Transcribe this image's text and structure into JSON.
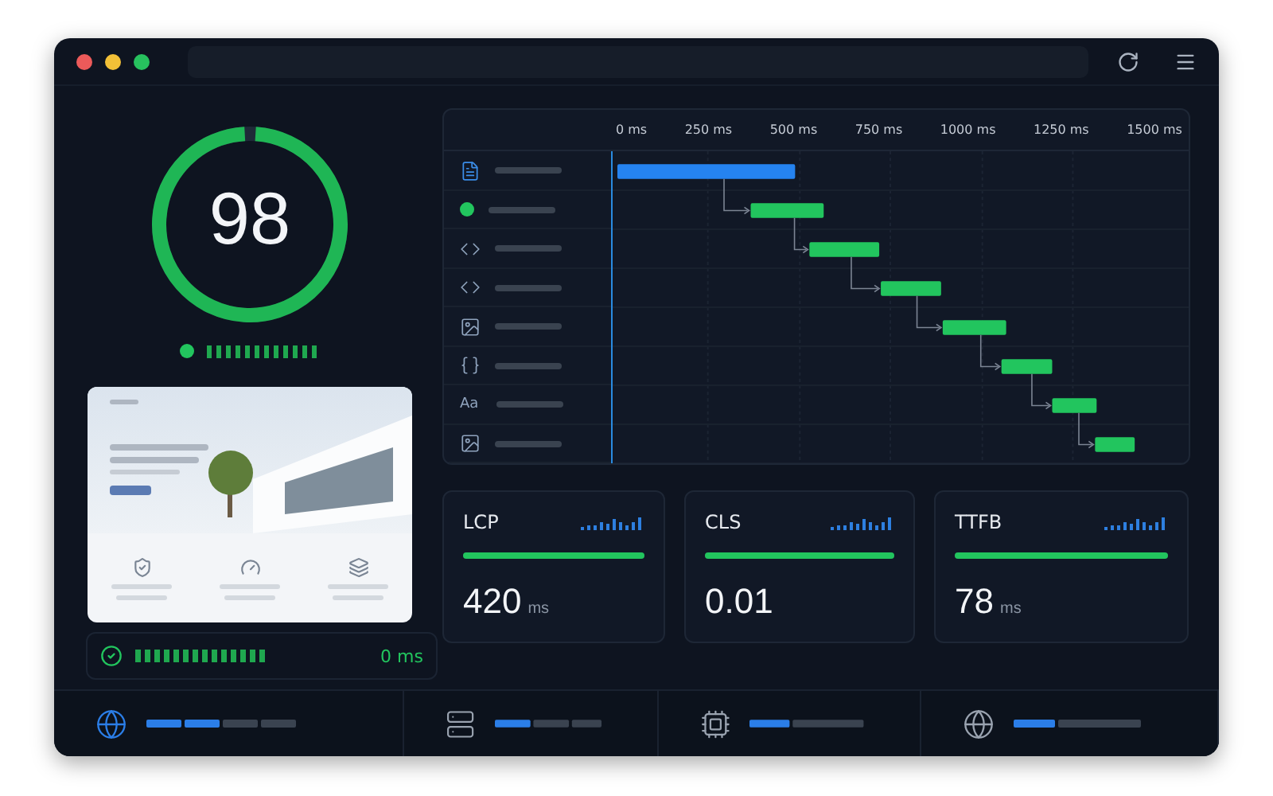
{
  "window": {
    "controls": [
      {
        "color": "#ec5a5a"
      },
      {
        "color": "#f2c037"
      },
      {
        "color": "#27c15e"
      }
    ]
  },
  "score": {
    "value": "98",
    "level": 0.98
  },
  "waterfall": {
    "ticks": [
      "0 ms",
      "250 ms",
      "500 ms",
      "750 ms",
      "1000 ms",
      "1250 ms",
      "1500 ms"
    ],
    "rows": [
      {
        "kind": "document"
      },
      {
        "kind": "dot"
      },
      {
        "kind": "code"
      },
      {
        "kind": "code"
      },
      {
        "kind": "image"
      },
      {
        "kind": "braces"
      },
      {
        "kind": "font",
        "label": "Aa"
      },
      {
        "kind": "image"
      }
    ]
  },
  "preview": {
    "status": "0 ms"
  },
  "metrics": [
    {
      "name": "LCP",
      "value": "420",
      "unit": "ms",
      "level": 1
    },
    {
      "name": "CLS",
      "value": "0.01",
      "level": 1
    },
    {
      "name": "TTFB",
      "value": "78",
      "unit": "ms",
      "level": 1
    }
  ],
  "footer": [
    {
      "kind": "globe",
      "selected": true
    },
    {
      "kind": "server",
      "selected": false
    },
    {
      "kind": "chip",
      "selected": false
    },
    {
      "kind": "globe",
      "selected": false
    }
  ]
}
